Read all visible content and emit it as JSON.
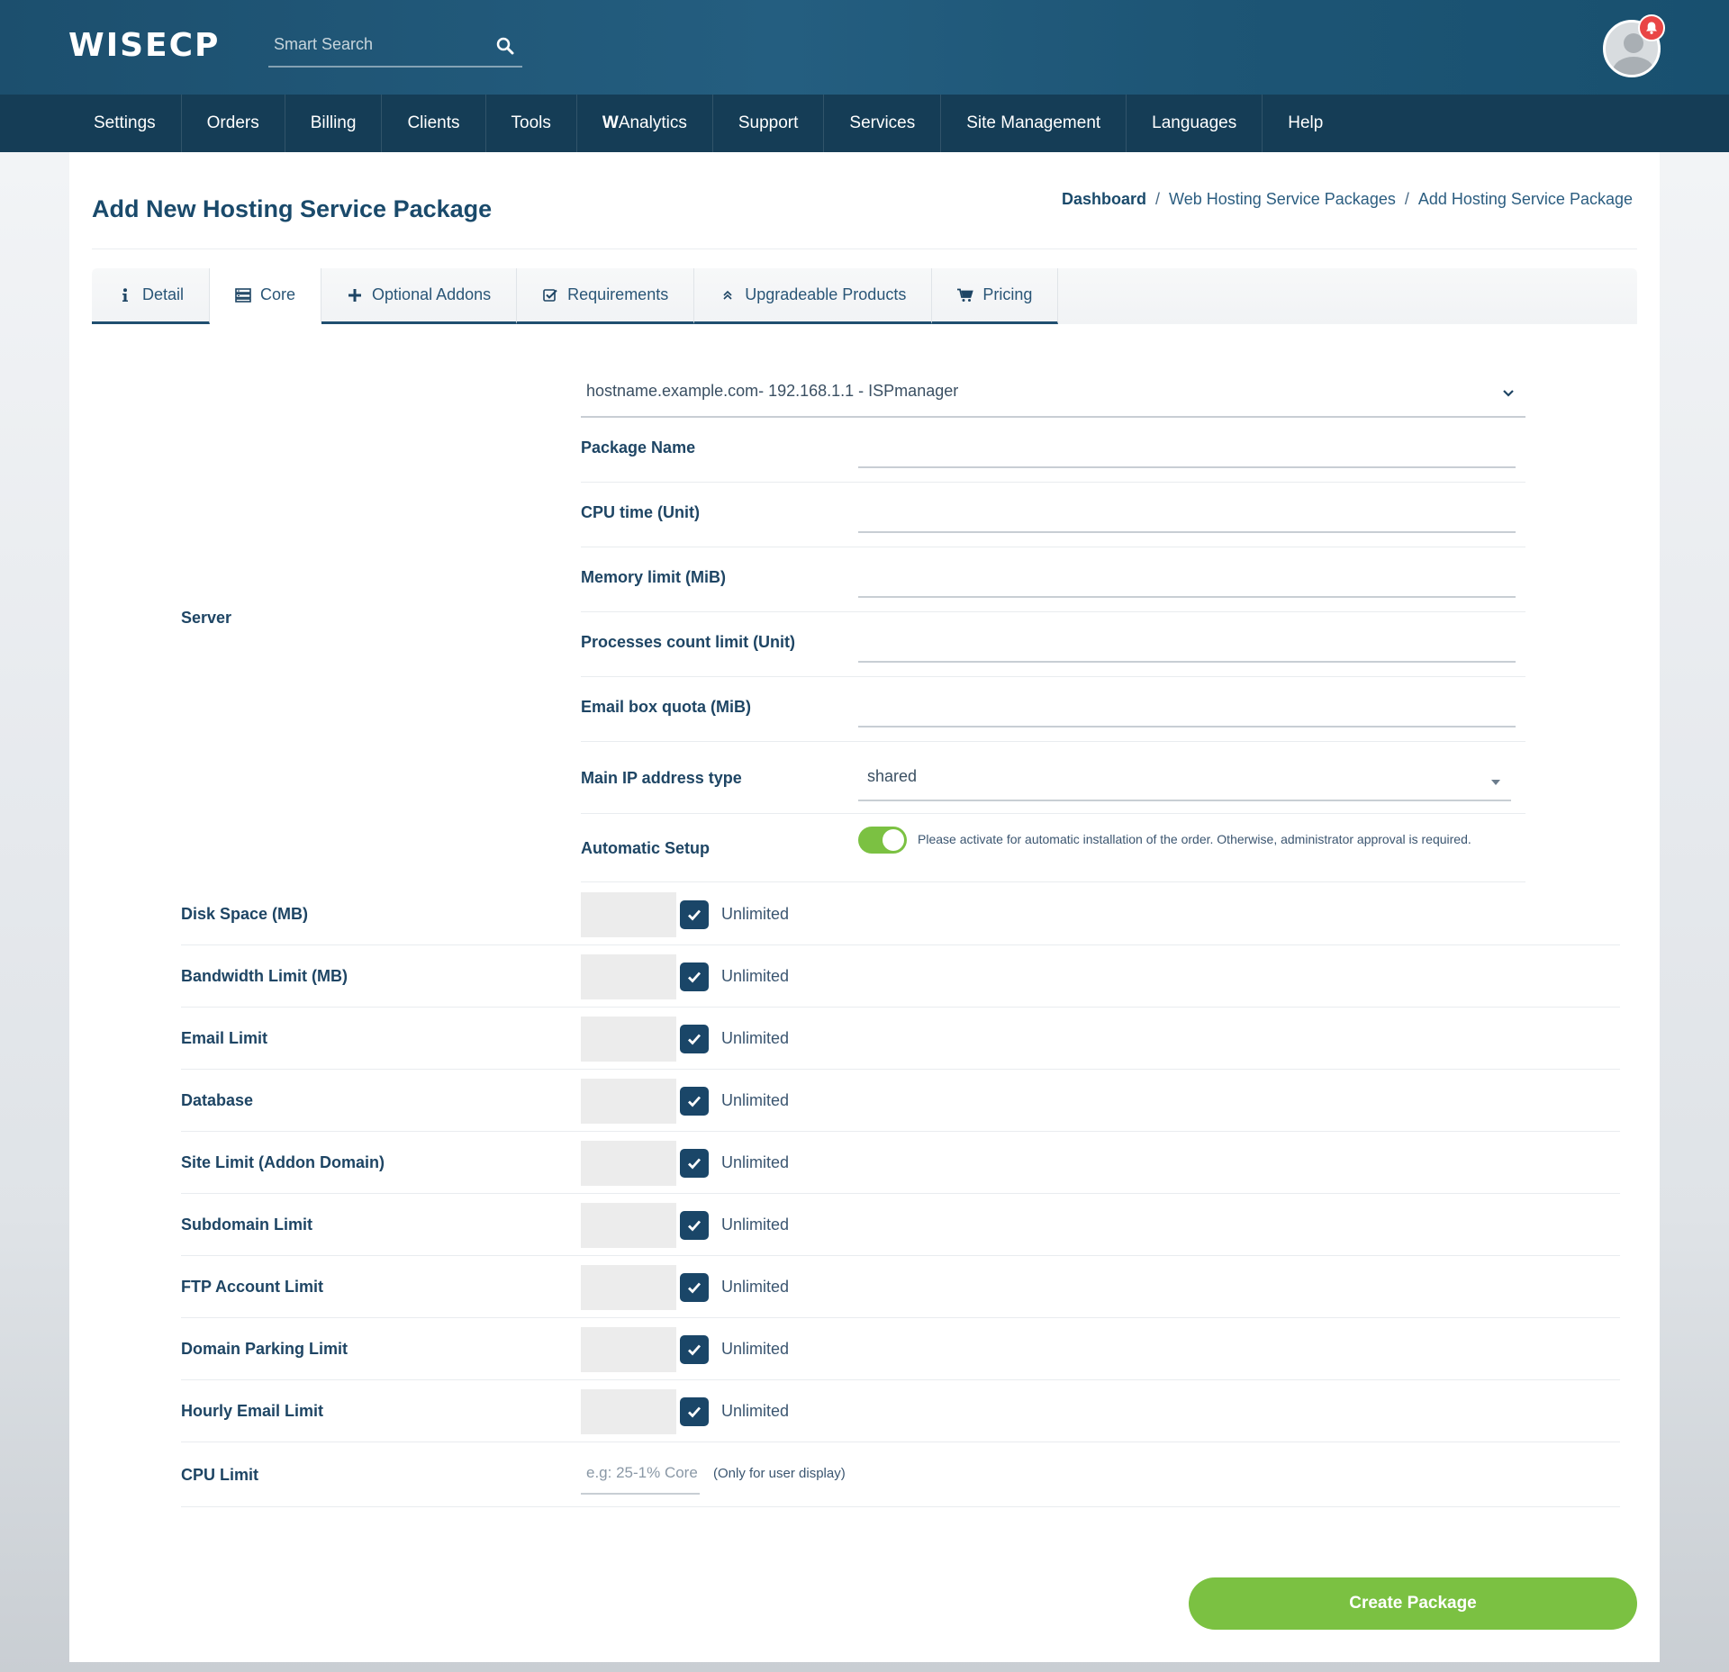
{
  "header": {
    "logo": "WISECP",
    "search_placeholder": "Smart Search"
  },
  "nav": [
    {
      "label": "Settings"
    },
    {
      "label": "Orders"
    },
    {
      "label": "Billing"
    },
    {
      "label": "Clients"
    },
    {
      "label": "Tools"
    },
    {
      "label_bold": "W",
      "label": "Analytics"
    },
    {
      "label": "Support"
    },
    {
      "label": "Services"
    },
    {
      "label": "Site Management"
    },
    {
      "label": "Languages"
    },
    {
      "label": "Help"
    }
  ],
  "page": {
    "title": "Add New Hosting Service Package",
    "breadcrumb": [
      "Dashboard",
      "Web Hosting Service Packages",
      "Add Hosting Service Package"
    ],
    "breadcrumb_sep": "/"
  },
  "tabs": [
    {
      "label": "Detail",
      "icon": "info-icon"
    },
    {
      "label": "Core",
      "icon": "server-icon"
    },
    {
      "label": "Optional Addons",
      "icon": "plus-icon"
    },
    {
      "label": "Requirements",
      "icon": "check-square-icon"
    },
    {
      "label": "Upgradeable Products",
      "icon": "double-chevron-up-icon"
    },
    {
      "label": "Pricing",
      "icon": "cart-icon"
    }
  ],
  "form": {
    "server_label": "Server",
    "server_value": "hostname.example.com- 192.168.1.1 - ISPmanager",
    "fields": [
      {
        "label": "Package Name",
        "value": ""
      },
      {
        "label": "CPU time (Unit)",
        "value": ""
      },
      {
        "label": "Memory limit (MiB)",
        "value": ""
      },
      {
        "label": "Processes count limit (Unit)",
        "value": ""
      },
      {
        "label": "Email box quota (MiB)",
        "value": ""
      }
    ],
    "ip_type_label": "Main IP address type",
    "ip_type_value": "shared",
    "auto_setup_label": "Automatic Setup",
    "auto_setup_note": "Please activate for automatic installation of the order. Otherwise, administrator approval is required.",
    "auto_setup_enabled": true,
    "limits": [
      {
        "label": "Disk Space (MB)",
        "unlimited": "Unlimited",
        "checked": true
      },
      {
        "label": "Bandwidth Limit (MB)",
        "unlimited": "Unlimited",
        "checked": true
      },
      {
        "label": "Email Limit",
        "unlimited": "Unlimited",
        "checked": true
      },
      {
        "label": "Database",
        "unlimited": "Unlimited",
        "checked": true
      },
      {
        "label": "Site Limit (Addon Domain)",
        "unlimited": "Unlimited",
        "checked": true
      },
      {
        "label": "Subdomain Limit",
        "unlimited": "Unlimited",
        "checked": true
      },
      {
        "label": "FTP Account Limit",
        "unlimited": "Unlimited",
        "checked": true
      },
      {
        "label": "Domain Parking Limit",
        "unlimited": "Unlimited",
        "checked": true
      },
      {
        "label": "Hourly Email Limit",
        "unlimited": "Unlimited",
        "checked": true
      }
    ],
    "cpu_limit_label": "CPU Limit",
    "cpu_limit_placeholder": "e.g: 25-1% Core",
    "cpu_limit_note": "(Only for user display)"
  },
  "actions": {
    "create_label": "Create Package"
  },
  "colors": {
    "accent": "#7bc142",
    "primary": "#1a4668",
    "nav_bg": "#153d56",
    "notification": "#e94545"
  }
}
